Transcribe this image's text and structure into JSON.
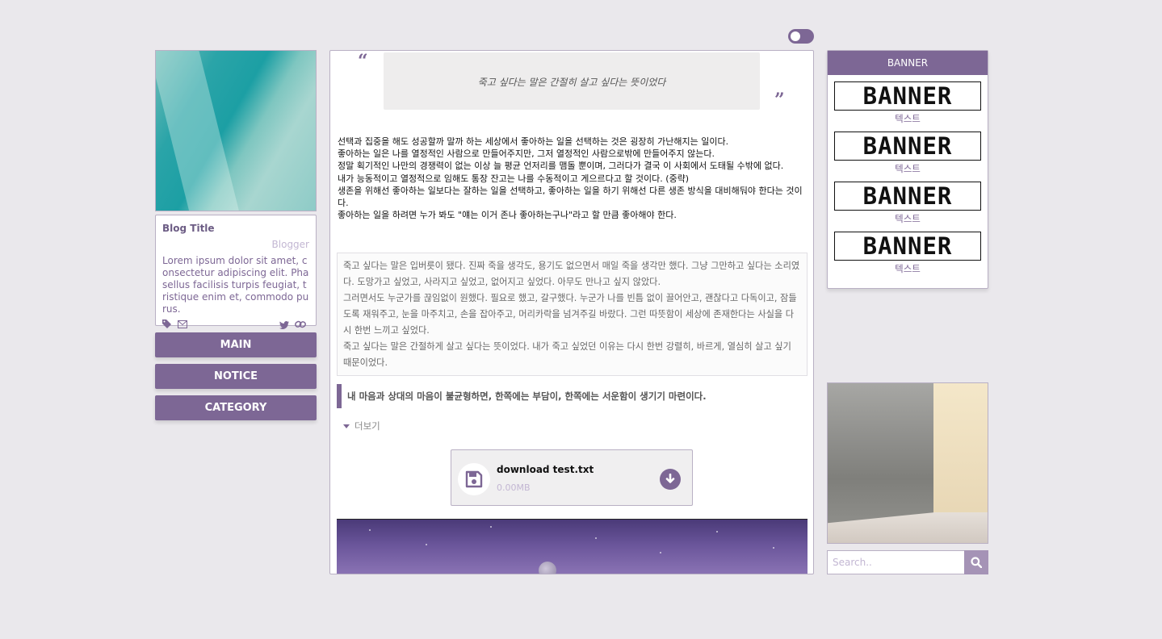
{
  "theme": {
    "accent": "#7d6795",
    "background": "#eae8ec",
    "muted": "#c3b7d3"
  },
  "toggle": {
    "state": "on"
  },
  "profile": {
    "blog_title": "Blog Title",
    "author": "Blogger",
    "description": "Lorem ipsum dolor sit amet, consectetur adipiscing elit. Phasellus facilisis turpis feugiat, tristique enim et, commodo purus.",
    "icons_left": [
      "tag-icon",
      "mail-icon"
    ],
    "icons_right": [
      "twitter-icon",
      "link-icon"
    ]
  },
  "nav": {
    "main": "MAIN",
    "notice": "NOTICE",
    "category": "CATEGORY"
  },
  "post": {
    "quote": "죽고 싶다는 말은 간절히 살고 싶다는 뜻이었다",
    "quote_open": "“",
    "quote_close": "”",
    "lines": [
      "선택과 집중을 해도 성공할까 말까 하는 세상에서 좋아하는 일을 선택하는 것은 굉장히 가난해지는 일이다.",
      "좋아하는 일은 나를 열정적인 사람으로 만들어주지만, 그저 열정적인 사람으로밖에 만들어주지 않는다.",
      "정말 획기적인 나만의 경쟁력이 없는 이상 늘 평균 언저리를 맴돌 뿐이며, 그러다가 결국 이 사회에서 도태될 수밖에 없다.",
      "내가 능동적이고 열정적으로 임해도 통장 잔고는 나를 수동적이고 게으르다고 할 것이다. (중략)",
      "생존을 위해선 좋아하는 일보다는 잘하는 일을 선택하고, 좋아하는 일을 하기 위해선 다른 생존 방식을 대비해둬야 한다는 것이다.",
      "좋아하는 일을 하려면 누가 봐도 \"얘는 이거 존나 좋아하는구나\"라고 할 만큼 좋아해야 한다."
    ],
    "note": [
      "죽고 싶다는 말은 입버릇이 됐다. 진짜 죽을 생각도, 용기도 없으면서 매일 죽을 생각만 했다. 그냥 그만하고 싶다는 소리였다. 도망가고 싶었고, 사라지고 싶었고, 없어지고 싶었다. 아무도 만나고 싶지 않았다.",
      "그러면서도 누군가를 끊임없이 원했다. 필요로 했고, 갈구했다. 누군가 나를 빈틈 없이 끌어안고, 괜찮다고 다독이고, 잠들도록 재워주고, 눈을 마주치고, 손을 잡아주고, 머리카락을 넘겨주길 바랐다. 그런 따뜻함이 세상에 존재한다는 사실을 다시 한번 느끼고 싶었다.",
      "죽고 싶다는 말은 간절하게 살고 싶다는 뜻이었다. 내가 죽고 싶었던 이유는 다시 한번 강렬히, 바르게, 열심히 살고 싶기 때문이었다."
    ],
    "blockquote": "내 마음과 상대의 마음이 불균형하면, 한쪽에는 부담이, 한쪽에는 서운함이 생기기 마련이다.",
    "more_label": "더보기",
    "file": {
      "name": "download test.txt",
      "size": "0.00MB"
    }
  },
  "sidebar": {
    "banner_title": "BANNER",
    "banners": [
      {
        "image_text": "BANNER",
        "label": "텍스트"
      },
      {
        "image_text": "BANNER",
        "label": "텍스트"
      },
      {
        "image_text": "BANNER",
        "label": "텍스트"
      },
      {
        "image_text": "BANNER",
        "label": "텍스트"
      }
    ],
    "search": {
      "placeholder": "Search..",
      "value": ""
    }
  }
}
